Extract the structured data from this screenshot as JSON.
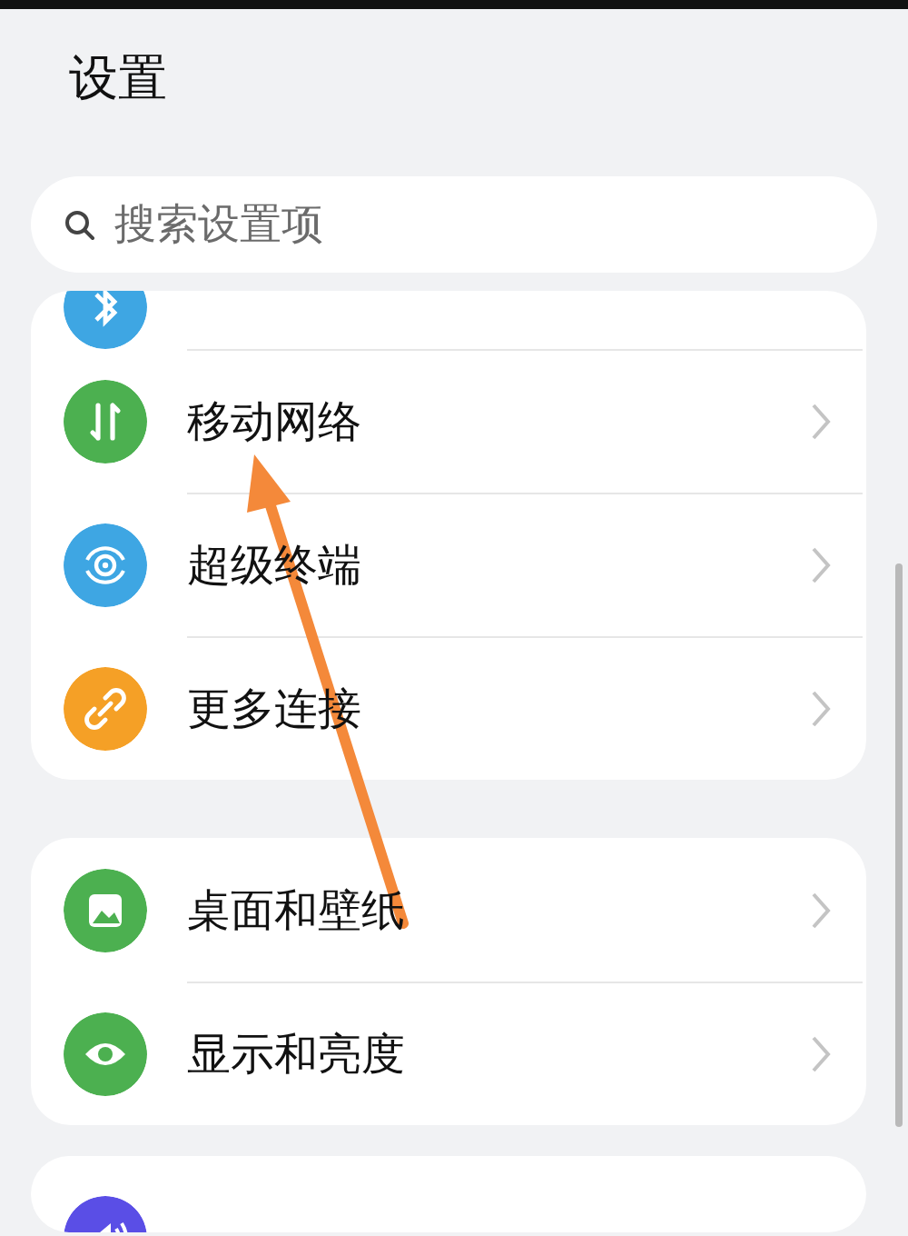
{
  "title": "设置",
  "search": {
    "placeholder": "搜索设置项"
  },
  "groups": [
    {
      "items": [
        {
          "kind": "partial",
          "color": "#3ea6e3"
        },
        {
          "kind": "row",
          "color": "#4cb050",
          "label": "移动网络"
        },
        {
          "kind": "row",
          "color": "#3ea6e3",
          "label": "超级终端"
        },
        {
          "kind": "row",
          "color": "#f5a026",
          "label": "更多连接"
        }
      ]
    },
    {
      "items": [
        {
          "kind": "row",
          "color": "#4cb050",
          "label": "桌面和壁纸"
        },
        {
          "kind": "row",
          "color": "#4cb050",
          "label": "显示和亮度"
        }
      ]
    },
    {
      "items": [
        {
          "kind": "partial-bottom",
          "color": "#5a4ee6"
        }
      ]
    }
  ]
}
